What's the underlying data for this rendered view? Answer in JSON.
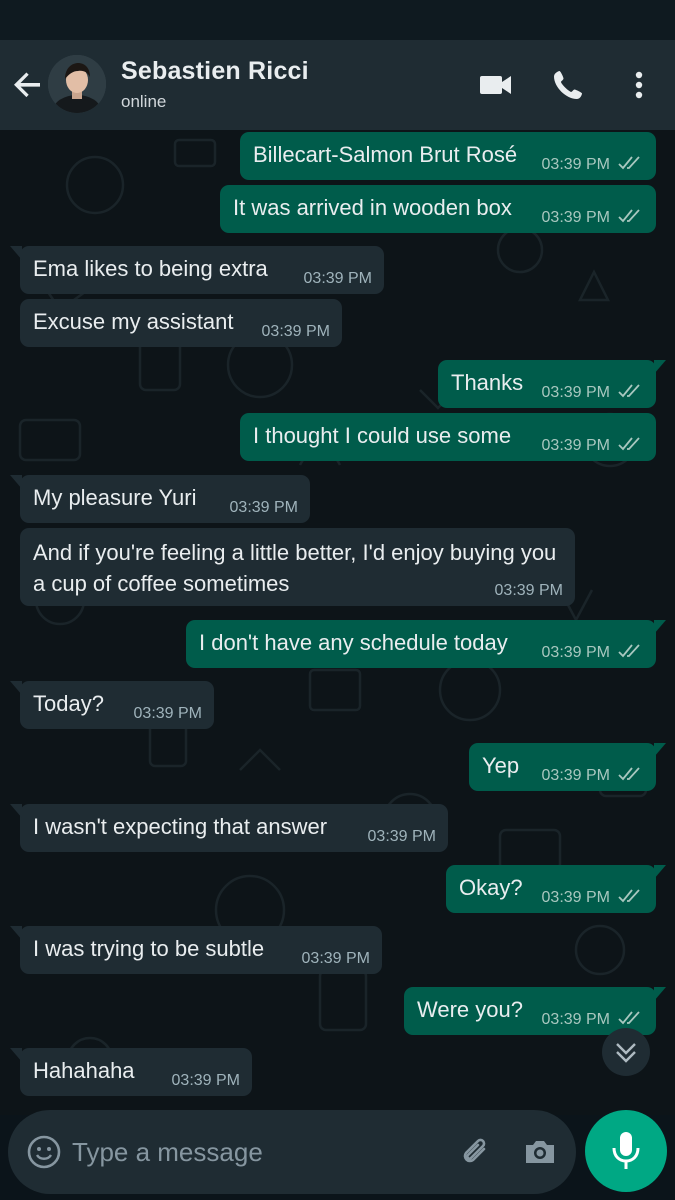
{
  "colors": {
    "header_bg": "#1f2c33",
    "outgoing_bubble": "#005c4b",
    "incoming_bubble": "#1f2c33",
    "chat_bg": "#0d1418",
    "accent": "#00a884"
  },
  "header": {
    "contact_name": "Sebastien Ricci",
    "status": "online",
    "icons": [
      "back-arrow-icon",
      "video-call-icon",
      "phone-icon",
      "more-vert-icon"
    ]
  },
  "messages": [
    {
      "dir": "out",
      "text": "Billecart-Salmon Brut Rosé",
      "time": "03:39 PM",
      "read": true
    },
    {
      "dir": "out",
      "text": "It was arrived in wooden box",
      "time": "03:39 PM",
      "read": true
    },
    {
      "dir": "in",
      "text": "Ema likes to being extra",
      "time": "03:39 PM"
    },
    {
      "dir": "in",
      "text": "Excuse my assistant",
      "time": "03:39 PM"
    },
    {
      "dir": "out",
      "text": "Thanks",
      "time": "03:39 PM",
      "read": true
    },
    {
      "dir": "out",
      "text": "I thought I could use some",
      "time": "03:39 PM",
      "read": true
    },
    {
      "dir": "in",
      "text": "My pleasure Yuri",
      "time": "03:39 PM"
    },
    {
      "dir": "in",
      "text": "And if you're feeling a little better, I'd enjoy buying you a cup of coffee sometimes",
      "time": "03:39 PM"
    },
    {
      "dir": "out",
      "text": "I don't have any schedule today",
      "time": "03:39 PM",
      "read": true
    },
    {
      "dir": "in",
      "text": "Today?",
      "time": "03:39 PM"
    },
    {
      "dir": "out",
      "text": "Yep",
      "time": "03:39 PM",
      "read": true
    },
    {
      "dir": "in",
      "text": "I wasn't expecting that answer",
      "time": "03:39 PM"
    },
    {
      "dir": "out",
      "text": "Okay?",
      "time": "03:39 PM",
      "read": true
    },
    {
      "dir": "in",
      "text": "I was trying to be subtle",
      "time": "03:39 PM"
    },
    {
      "dir": "out",
      "text": "Were you?",
      "time": "03:39 PM",
      "read": true
    },
    {
      "dir": "in",
      "text": "Hahahaha",
      "time": "03:39 PM"
    }
  ],
  "composer": {
    "placeholder": "Type a message",
    "icons": [
      "emoji-icon",
      "attach-icon",
      "camera-icon",
      "mic-icon"
    ]
  }
}
